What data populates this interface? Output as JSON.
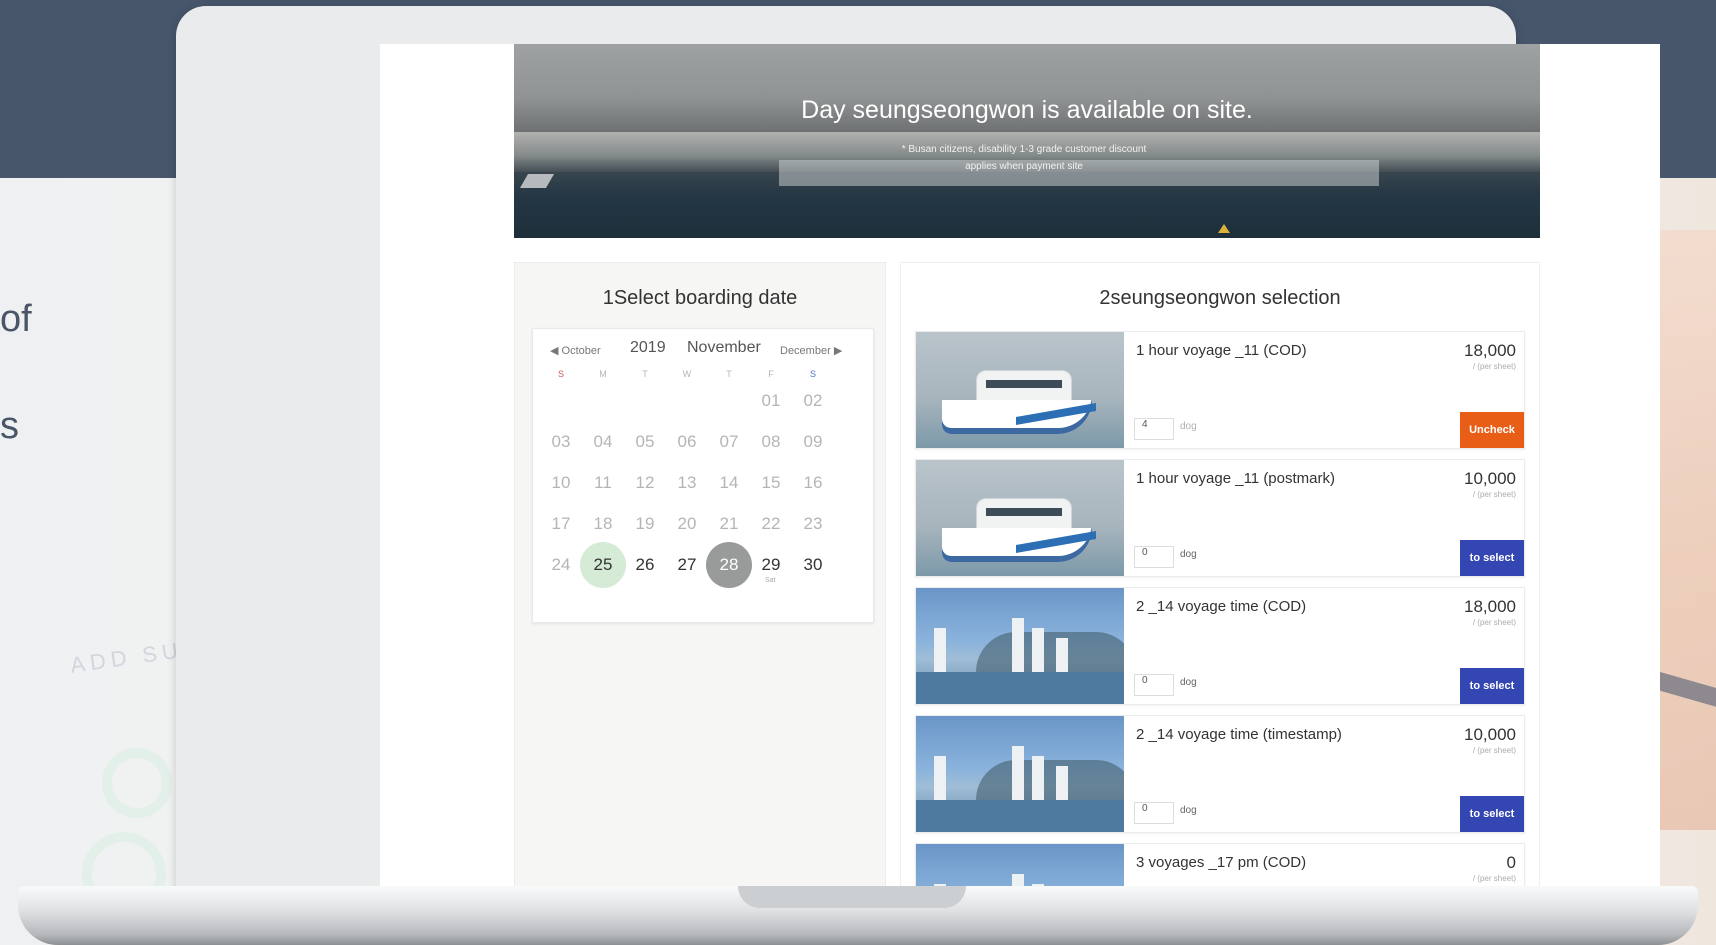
{
  "background": {
    "side_text": [
      "of",
      "s"
    ],
    "faded_text": "ADD SU"
  },
  "banner": {
    "title": "Day seungseongwon is available on site.",
    "note": "* Busan citizens, disability 1-3 grade customer discount applies when payment site"
  },
  "date_panel": {
    "heading": "1Select boarding date",
    "calendar": {
      "prev": "October",
      "year": "2019",
      "month": "November",
      "next": "December",
      "weekdays": [
        "S",
        "M",
        "T",
        "W",
        "T",
        "F",
        "S"
      ],
      "weeks": [
        [
          "",
          "",
          "",
          "",
          "",
          "01",
          "02"
        ],
        [
          "03",
          "04",
          "05",
          "06",
          "07",
          "08",
          "09"
        ],
        [
          "10",
          "11",
          "12",
          "13",
          "14",
          "15",
          "16"
        ],
        [
          "17",
          "18",
          "19",
          "20",
          "21",
          "22",
          "23"
        ],
        [
          "24",
          "25",
          "26",
          "27",
          "28",
          "29",
          "30"
        ]
      ],
      "today": "25",
      "selected": "28",
      "day_29_note": "Sat"
    }
  },
  "selection_panel": {
    "heading": "2seungseongwon selection",
    "items": [
      {
        "title": "1 hour voyage _11 (COD)",
        "price": "18,000",
        "unit": "/ (per sheet)",
        "qty": "4",
        "qty_unit": "dog",
        "action": "Uncheck",
        "state": "checked",
        "image": "ship"
      },
      {
        "title": "1 hour voyage _11 (postmark)",
        "price": "10,000",
        "unit": "/ (per sheet)",
        "qty": "0",
        "qty_unit": "dog",
        "action": "to select",
        "state": "unchecked",
        "image": "ship"
      },
      {
        "title": "2 _14 voyage time (COD)",
        "price": "18,000",
        "unit": "/ (per sheet)",
        "qty": "0",
        "qty_unit": "dog",
        "action": "to select",
        "state": "unchecked",
        "image": "harbor"
      },
      {
        "title": "2 _14 voyage time (timestamp)",
        "price": "10,000",
        "unit": "/ (per sheet)",
        "qty": "0",
        "qty_unit": "dog",
        "action": "to select",
        "state": "unchecked",
        "image": "harbor"
      },
      {
        "title": "3 voyages _17 pm (COD)",
        "price": "0",
        "unit": "/ (per sheet)",
        "qty": "",
        "qty_unit": "",
        "action": "",
        "state": "partial",
        "image": "harbor"
      }
    ]
  },
  "colors": {
    "band": "#47566b",
    "uncheck": "#e85e16",
    "select": "#3446b2",
    "today": "#d5ebd6",
    "selected": "#999a9a"
  }
}
